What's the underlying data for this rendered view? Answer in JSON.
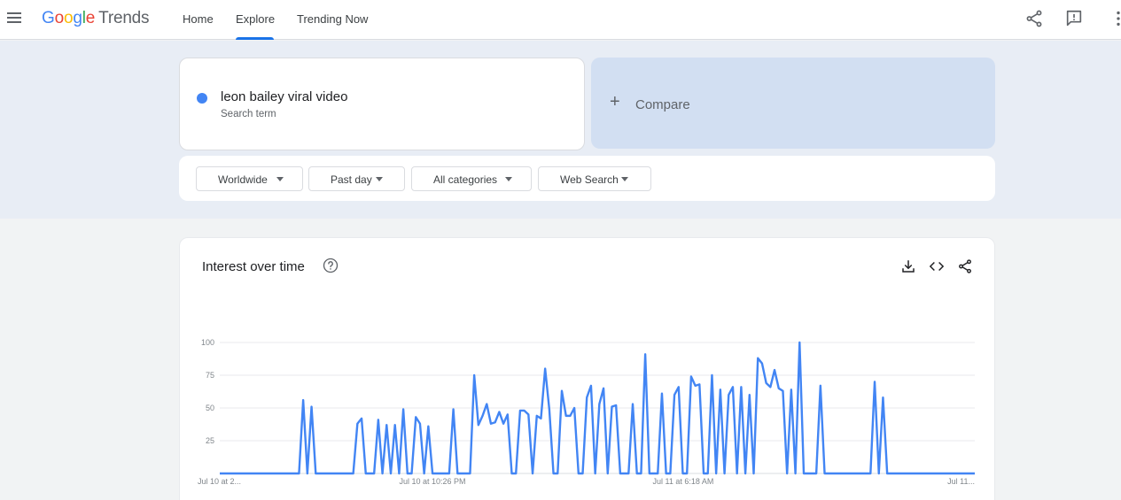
{
  "header": {
    "logo_google": [
      "G",
      "o",
      "o",
      "g",
      "l",
      "e"
    ],
    "logo_trends": "Trends",
    "nav": [
      {
        "label": "Home",
        "active": false
      },
      {
        "label": "Explore",
        "active": true
      },
      {
        "label": "Trending Now",
        "active": false
      }
    ],
    "icons": [
      "share-icon",
      "feedback-icon",
      "more-vert-icon"
    ]
  },
  "search": {
    "term": "leon bailey viral video",
    "term_type": "Search term",
    "term_color": "#4285f4",
    "compare_label": "Compare"
  },
  "filters": [
    {
      "label": "Worldwide"
    },
    {
      "label": "Past day"
    },
    {
      "label": "All categories"
    },
    {
      "label": "Web Search"
    }
  ],
  "interest_card": {
    "title": "Interest over time",
    "icons": [
      "help-icon",
      "download-icon",
      "embed-code-icon",
      "share-icon"
    ]
  },
  "chart_data": {
    "type": "line",
    "title": "Interest over time",
    "ylim": [
      0,
      100
    ],
    "y_ticks": [
      25,
      50,
      75,
      100
    ],
    "x_tick_labels": [
      "Jul 10 at 2...",
      "Jul 10 at 10:26 PM",
      "Jul 11 at 6:18 AM",
      "Jul 11..."
    ],
    "grid": true,
    "series": [
      {
        "color": "#4285f4",
        "values": [
          0,
          0,
          0,
          0,
          0,
          0,
          0,
          0,
          0,
          0,
          0,
          0,
          0,
          0,
          0,
          0,
          0,
          0,
          0,
          0,
          56,
          0,
          51,
          0,
          0,
          0,
          0,
          0,
          0,
          0,
          0,
          0,
          0,
          38,
          42,
          0,
          0,
          0,
          41,
          0,
          37,
          0,
          37,
          0,
          49,
          0,
          0,
          43,
          38,
          0,
          36,
          0,
          0,
          0,
          0,
          0,
          49,
          0,
          0,
          0,
          0,
          75,
          37,
          44,
          53,
          38,
          39,
          47,
          38,
          45,
          0,
          0,
          48,
          48,
          45,
          0,
          44,
          42,
          80,
          49,
          0,
          0,
          63,
          44,
          44,
          50,
          0,
          0,
          58,
          67,
          0,
          53,
          65,
          0,
          51,
          52,
          0,
          0,
          0,
          53,
          0,
          0,
          91,
          0,
          0,
          0,
          61,
          0,
          0,
          60,
          66,
          0,
          0,
          74,
          67,
          68,
          0,
          0,
          75,
          0,
          64,
          0,
          60,
          66,
          0,
          66,
          0,
          60,
          0,
          88,
          84,
          69,
          66,
          79,
          65,
          63,
          0,
          64,
          0,
          100,
          0,
          0,
          0,
          0,
          67,
          0,
          0,
          0,
          0,
          0,
          0,
          0,
          0,
          0,
          0,
          0,
          0,
          70,
          0,
          58,
          0,
          0,
          0,
          0,
          0,
          0,
          0,
          0,
          0,
          0,
          0,
          0,
          0,
          0,
          0,
          0,
          0,
          0,
          0,
          0,
          0,
          0
        ]
      }
    ]
  }
}
